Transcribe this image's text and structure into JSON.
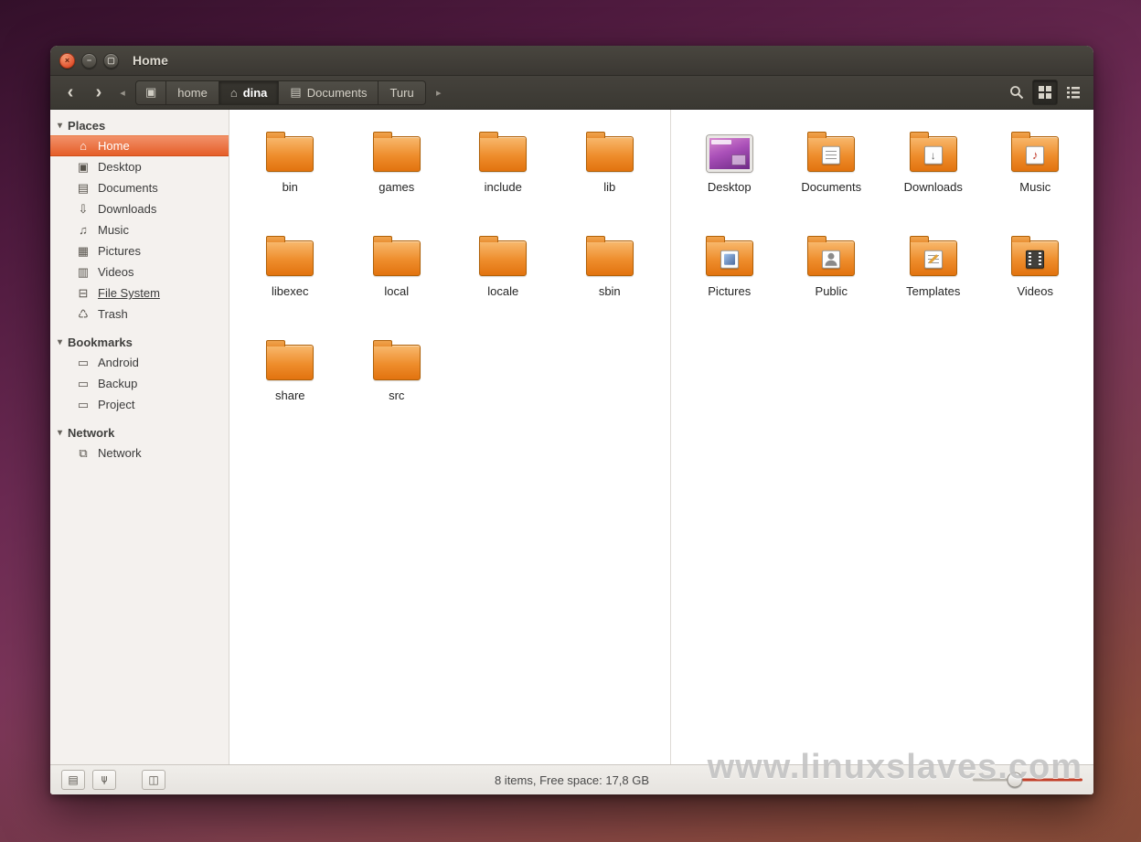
{
  "window": {
    "title": "Home",
    "controls": {
      "close": "×",
      "minimize": "−",
      "maximize": "▢"
    }
  },
  "icons": {
    "back": "‹",
    "forward": "›",
    "crumb_scroll_left": "◂",
    "crumb_scroll_right": "▸",
    "root": "▣",
    "home": "⌂",
    "document": "▤",
    "desktop": "▣",
    "downloads": "⇩",
    "music": "♫",
    "pictures": "▦",
    "videos": "▥",
    "filesystem": "⊟",
    "trash": "♺",
    "folder": "▭",
    "network": "⧉",
    "triangle": "▾",
    "emblem_downloads": "↓",
    "emblem_music": "♪",
    "statusbar_places": "▤",
    "statusbar_tree": "⋔",
    "statusbar_split": "◫"
  },
  "toolbar": {
    "breadcrumbs": [
      {
        "label": "home"
      },
      {
        "label": "dina",
        "current": true
      },
      {
        "label": "Documents"
      },
      {
        "label": "Turu"
      }
    ]
  },
  "sidebar": {
    "sections": [
      {
        "label": "Places",
        "items": [
          {
            "label": "Home",
            "selected": true
          },
          {
            "label": "Desktop"
          },
          {
            "label": "Documents"
          },
          {
            "label": "Downloads"
          },
          {
            "label": "Music"
          },
          {
            "label": "Pictures"
          },
          {
            "label": "Videos"
          },
          {
            "label": "File System",
            "underlined": true
          },
          {
            "label": "Trash"
          }
        ]
      },
      {
        "label": "Bookmarks",
        "items": [
          {
            "label": "Android"
          },
          {
            "label": "Backup"
          },
          {
            "label": "Project"
          }
        ]
      },
      {
        "label": "Network",
        "items": [
          {
            "label": "Network"
          }
        ]
      }
    ]
  },
  "panes": {
    "left": {
      "items": [
        "bin",
        "games",
        "include",
        "lib",
        "libexec",
        "local",
        "locale",
        "sbin",
        "share",
        "src"
      ]
    },
    "right": {
      "items": [
        {
          "label": "Desktop",
          "emblem": "desktop-screen"
        },
        {
          "label": "Documents",
          "emblem": "document"
        },
        {
          "label": "Downloads",
          "emblem": "down-arrow"
        },
        {
          "label": "Music",
          "emblem": "music-note"
        },
        {
          "label": "Pictures",
          "emblem": "photo"
        },
        {
          "label": "Public",
          "emblem": "person"
        },
        {
          "label": "Templates",
          "emblem": "template"
        },
        {
          "label": "Videos",
          "emblem": "filmstrip"
        }
      ]
    }
  },
  "statusbar": {
    "text": "8 items, Free space: 17,8 GB"
  },
  "watermark": "www.linuxslaves.com",
  "colors": {
    "accent_orange": "#e55e28",
    "folder_orange": "#ee8d2c",
    "chrome_dark": "#3e3c36",
    "sidebar_bg": "#f4f1ee"
  }
}
